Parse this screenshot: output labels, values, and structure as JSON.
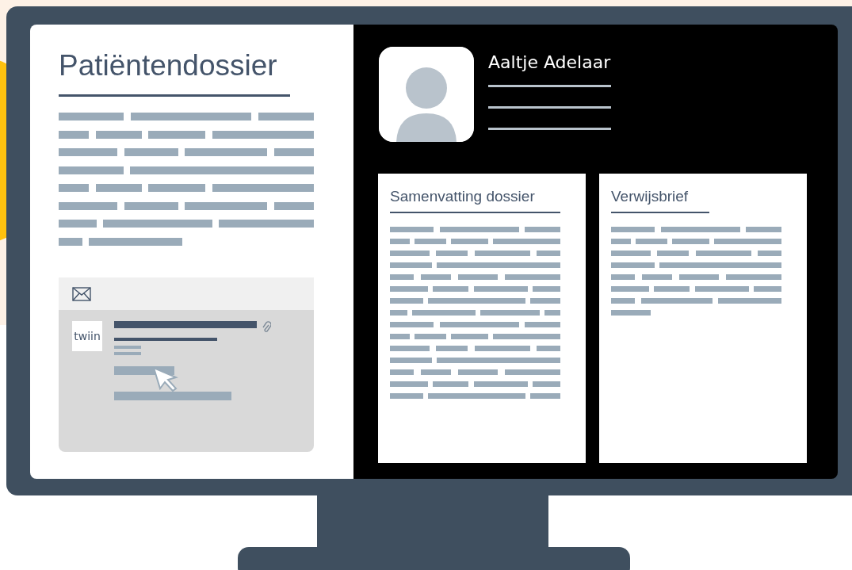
{
  "left_panel": {
    "title": "Patiëntendossier",
    "message": {
      "sender_logo": "twiin"
    }
  },
  "patient": {
    "name": "Aaltje Adelaar"
  },
  "documents": [
    {
      "title": "Samenvatting dossier"
    },
    {
      "title": "Verwijsbrief"
    }
  ]
}
